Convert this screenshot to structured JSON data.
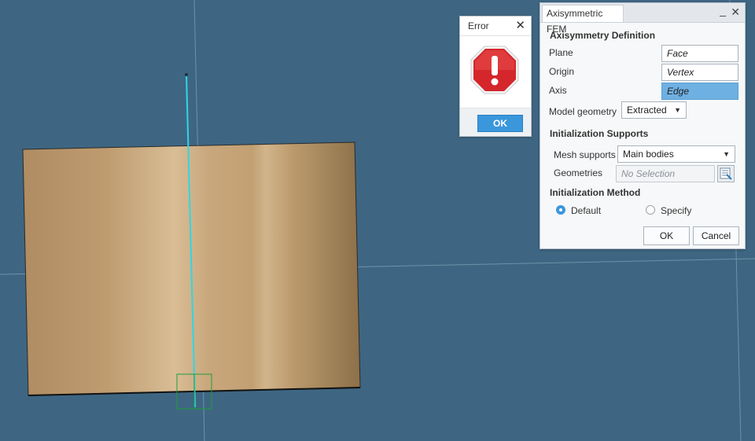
{
  "error_dialog": {
    "title": "Error",
    "ok_label": "OK"
  },
  "fem_panel": {
    "tab_title": "Axisymmetric FEM",
    "axisymmetry_section": "Axisymmetry Definition",
    "plane_label": "Plane",
    "plane_value": "Face",
    "origin_label": "Origin",
    "origin_value": "Vertex",
    "axis_label": "Axis",
    "axis_value": "Edge",
    "model_geometry_label": "Model geometry",
    "model_geometry_value": "Extracted",
    "init_supports_section": "Initialization Supports",
    "mesh_supports_label": "Mesh supports",
    "mesh_supports_value": "Main bodies",
    "geometries_label": "Geometries",
    "geometries_placeholder": "No Selection",
    "init_method_section": "Initialization Method",
    "radio_default": "Default",
    "radio_specify": "Specify",
    "ok_label": "OK",
    "cancel_label": "Cancel"
  },
  "colors": {
    "background": "#3e6682",
    "cylinder": "#c7a57c",
    "axis_line": "#2ed6e6",
    "selection_box": "#1f9e3a",
    "accent": "#3a97dc"
  }
}
